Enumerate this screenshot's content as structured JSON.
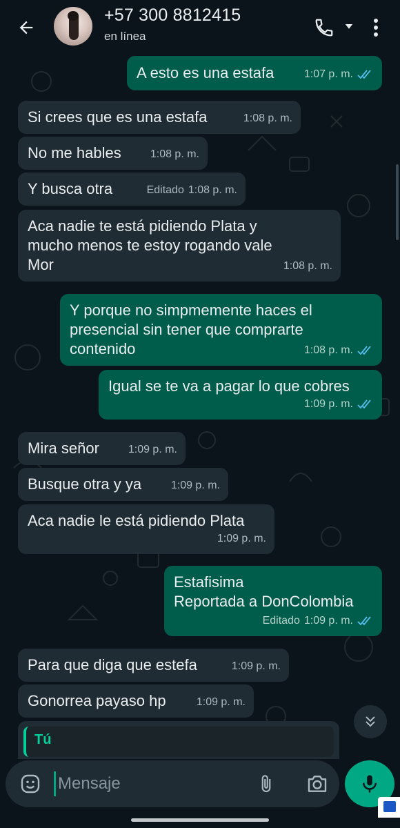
{
  "header": {
    "contact_name": "+57 300 8812415",
    "status": "en línea"
  },
  "messages": [
    {
      "dir": "out",
      "text": "A esto es una estafa",
      "time": "1:07 p. m.",
      "edited": "",
      "read": true
    },
    {
      "dir": "in",
      "text": "Si crees que es una estafa",
      "time": "1:08 p. m.",
      "edited": ""
    },
    {
      "dir": "in",
      "text": "No me hables",
      "time": "1:08 p. m.",
      "edited": ""
    },
    {
      "dir": "in",
      "text": "Y busca otra",
      "time": "1:08 p. m.",
      "edited": "Editado"
    },
    {
      "dir": "in",
      "lines": [
        "Aca nadie te está pidiendo Plata y",
        "mucho menos te estoy rogando vale",
        "Mor"
      ],
      "time": "1:08 p. m.",
      "edited": ""
    },
    {
      "dir": "out",
      "lines": [
        "Y porque no simpmemente haces el",
        "presencial sin tener que comprarte",
        "contenido"
      ],
      "time": "1:08 p. m.",
      "edited": "",
      "read": true
    },
    {
      "dir": "out",
      "text": "Igual se te va a pagar lo que cobres",
      "time": "1:09 p. m.",
      "edited": "",
      "read": true
    },
    {
      "dir": "in",
      "text": "Mira señor",
      "time": "1:09 p. m.",
      "edited": ""
    },
    {
      "dir": "in",
      "text": "Busque otra y ya",
      "time": "1:09 p. m.",
      "edited": ""
    },
    {
      "dir": "in",
      "text": "Aca nadie le está pidiendo Plata",
      "time": "1:09 p. m.",
      "edited": ""
    },
    {
      "dir": "out",
      "lines": [
        "Estafisima",
        "Reportada a DonColombia"
      ],
      "time": "1:09 p. m.",
      "edited": "Editado",
      "read": true
    },
    {
      "dir": "in",
      "text": "Para que diga que estefa",
      "time": "1:09 p. m.",
      "edited": ""
    },
    {
      "dir": "in",
      "text": "Gonorrea payaso hp",
      "time": "1:09 p. m.",
      "edited": ""
    }
  ],
  "reply_preview": {
    "sender": "Tú"
  },
  "composer": {
    "placeholder": "Mensaje"
  },
  "icons": {
    "back": "arrow-left-icon",
    "call": "phone-icon",
    "call_dropdown": "caret-down-icon",
    "menu": "more-vertical-icon",
    "scroll_down": "double-chevron-down-icon",
    "emoji": "emoji-icon",
    "attach": "paperclip-icon",
    "camera": "camera-icon",
    "mic": "mic-icon",
    "read_receipt": "double-check-icon"
  },
  "colors": {
    "background": "#0b141a",
    "incoming_bubble": "#202c33",
    "outgoing_bubble": "#005c4b",
    "accent": "#00a884",
    "read_tick": "#53bdeb"
  }
}
